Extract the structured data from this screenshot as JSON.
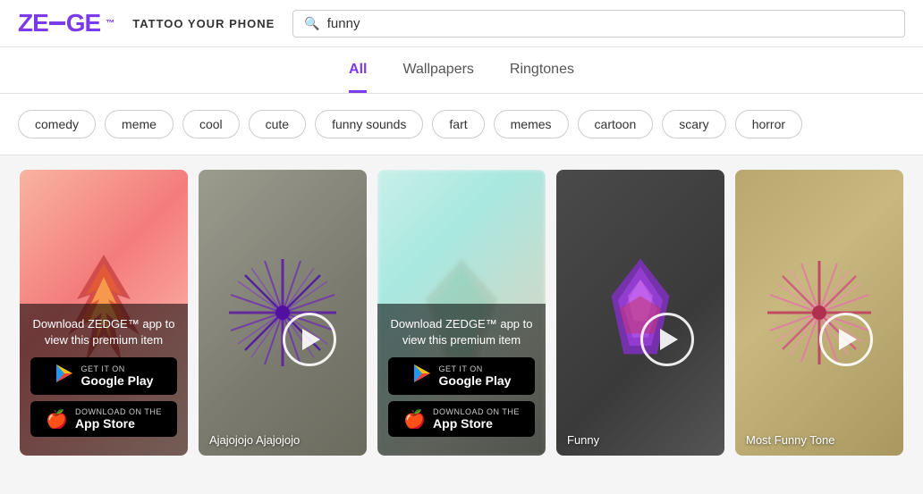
{
  "header": {
    "logo": "ZEDGE",
    "tagline": "TATTOO YOUR PHONE",
    "search": {
      "placeholder": "funny",
      "value": "funny"
    }
  },
  "tabs": [
    {
      "label": "All",
      "active": true
    },
    {
      "label": "Wallpapers",
      "active": false
    },
    {
      "label": "Ringtones",
      "active": false
    }
  ],
  "tags": [
    "comedy",
    "meme",
    "cool",
    "cute",
    "funny sounds",
    "fart",
    "memes",
    "cartoon",
    "scary",
    "horror"
  ],
  "cards": [
    {
      "id": 1,
      "label": "",
      "hasDownloadOverlay": true,
      "downloadText": "Download ZEDGE™ app to view this premium item",
      "googlePlayLabel": "GET IT ON",
      "googlePlayStore": "Google Play",
      "appStoreLabel": "Download on the",
      "appStore": "App Store",
      "colorScheme": "pink"
    },
    {
      "id": 2,
      "label": "Ajajojojo Ajajojojo",
      "hasDownloadOverlay": false,
      "colorScheme": "grey"
    },
    {
      "id": 3,
      "label": "",
      "hasDownloadOverlay": true,
      "downloadText": "Download ZEDGE™ app to view this premium item",
      "googlePlayLabel": "GET IT ON",
      "googlePlayStore": "Google Play",
      "appStoreLabel": "Download on the",
      "appStore": "App Store",
      "colorScheme": "teal"
    },
    {
      "id": 4,
      "label": "Funny",
      "hasDownloadOverlay": false,
      "colorScheme": "dark"
    },
    {
      "id": 5,
      "label": "Most Funny Tone",
      "hasDownloadOverlay": false,
      "colorScheme": "olive"
    }
  ],
  "icons": {
    "search": "🔍",
    "play": "▶",
    "apple": "",
    "googlePlay": "▶"
  }
}
